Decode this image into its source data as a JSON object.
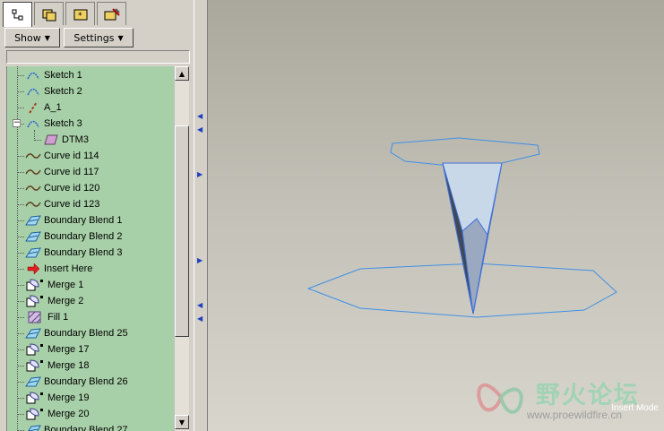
{
  "toolbar": {
    "show_label": "Show",
    "settings_label": "Settings"
  },
  "tree": {
    "items": [
      {
        "label": "Sketch 1",
        "icon": "sketch-icon"
      },
      {
        "label": "Sketch 2",
        "icon": "sketch-icon"
      },
      {
        "label": "A_1",
        "icon": "axis-icon"
      },
      {
        "label": "Sketch 3",
        "icon": "sketch-icon"
      },
      {
        "label": "DTM3",
        "icon": "datum-plane-icon"
      },
      {
        "label": "Curve id 114",
        "icon": "curve-icon"
      },
      {
        "label": "Curve id 117",
        "icon": "curve-icon"
      },
      {
        "label": "Curve id 120",
        "icon": "curve-icon"
      },
      {
        "label": "Curve id 123",
        "icon": "curve-icon"
      },
      {
        "label": "Boundary Blend 1",
        "icon": "boundary-blend-icon"
      },
      {
        "label": "Boundary Blend 2",
        "icon": "boundary-blend-icon"
      },
      {
        "label": "Boundary Blend 3",
        "icon": "boundary-blend-icon"
      },
      {
        "label": "Insert Here",
        "icon": "insert-arrow-icon"
      },
      {
        "label": "Merge 1",
        "icon": "merge-icon"
      },
      {
        "label": "Merge 2",
        "icon": "merge-icon"
      },
      {
        "label": "Fill 1",
        "icon": "fill-icon"
      },
      {
        "label": "Boundary Blend 25",
        "icon": "boundary-blend-icon"
      },
      {
        "label": "Merge 17",
        "icon": "merge-icon"
      },
      {
        "label": "Merge 18",
        "icon": "merge-icon"
      },
      {
        "label": "Boundary Blend 26",
        "icon": "boundary-blend-icon"
      },
      {
        "label": "Merge 19",
        "icon": "merge-icon"
      },
      {
        "label": "Merge 20",
        "icon": "merge-icon"
      },
      {
        "label": "Boundary Blend 27",
        "icon": "boundary-blend-icon"
      }
    ]
  },
  "viewport": {
    "status_text": "Insert Mode"
  },
  "watermark": {
    "brand_text": "野火论坛",
    "url_text": "www.proewildfire.cn"
  },
  "colors": {
    "tree_bg": "#a8d0a8",
    "edge_blue": "#3f8fe6",
    "surface_light": "#c8d8e8",
    "surface_dark": "#404858"
  }
}
